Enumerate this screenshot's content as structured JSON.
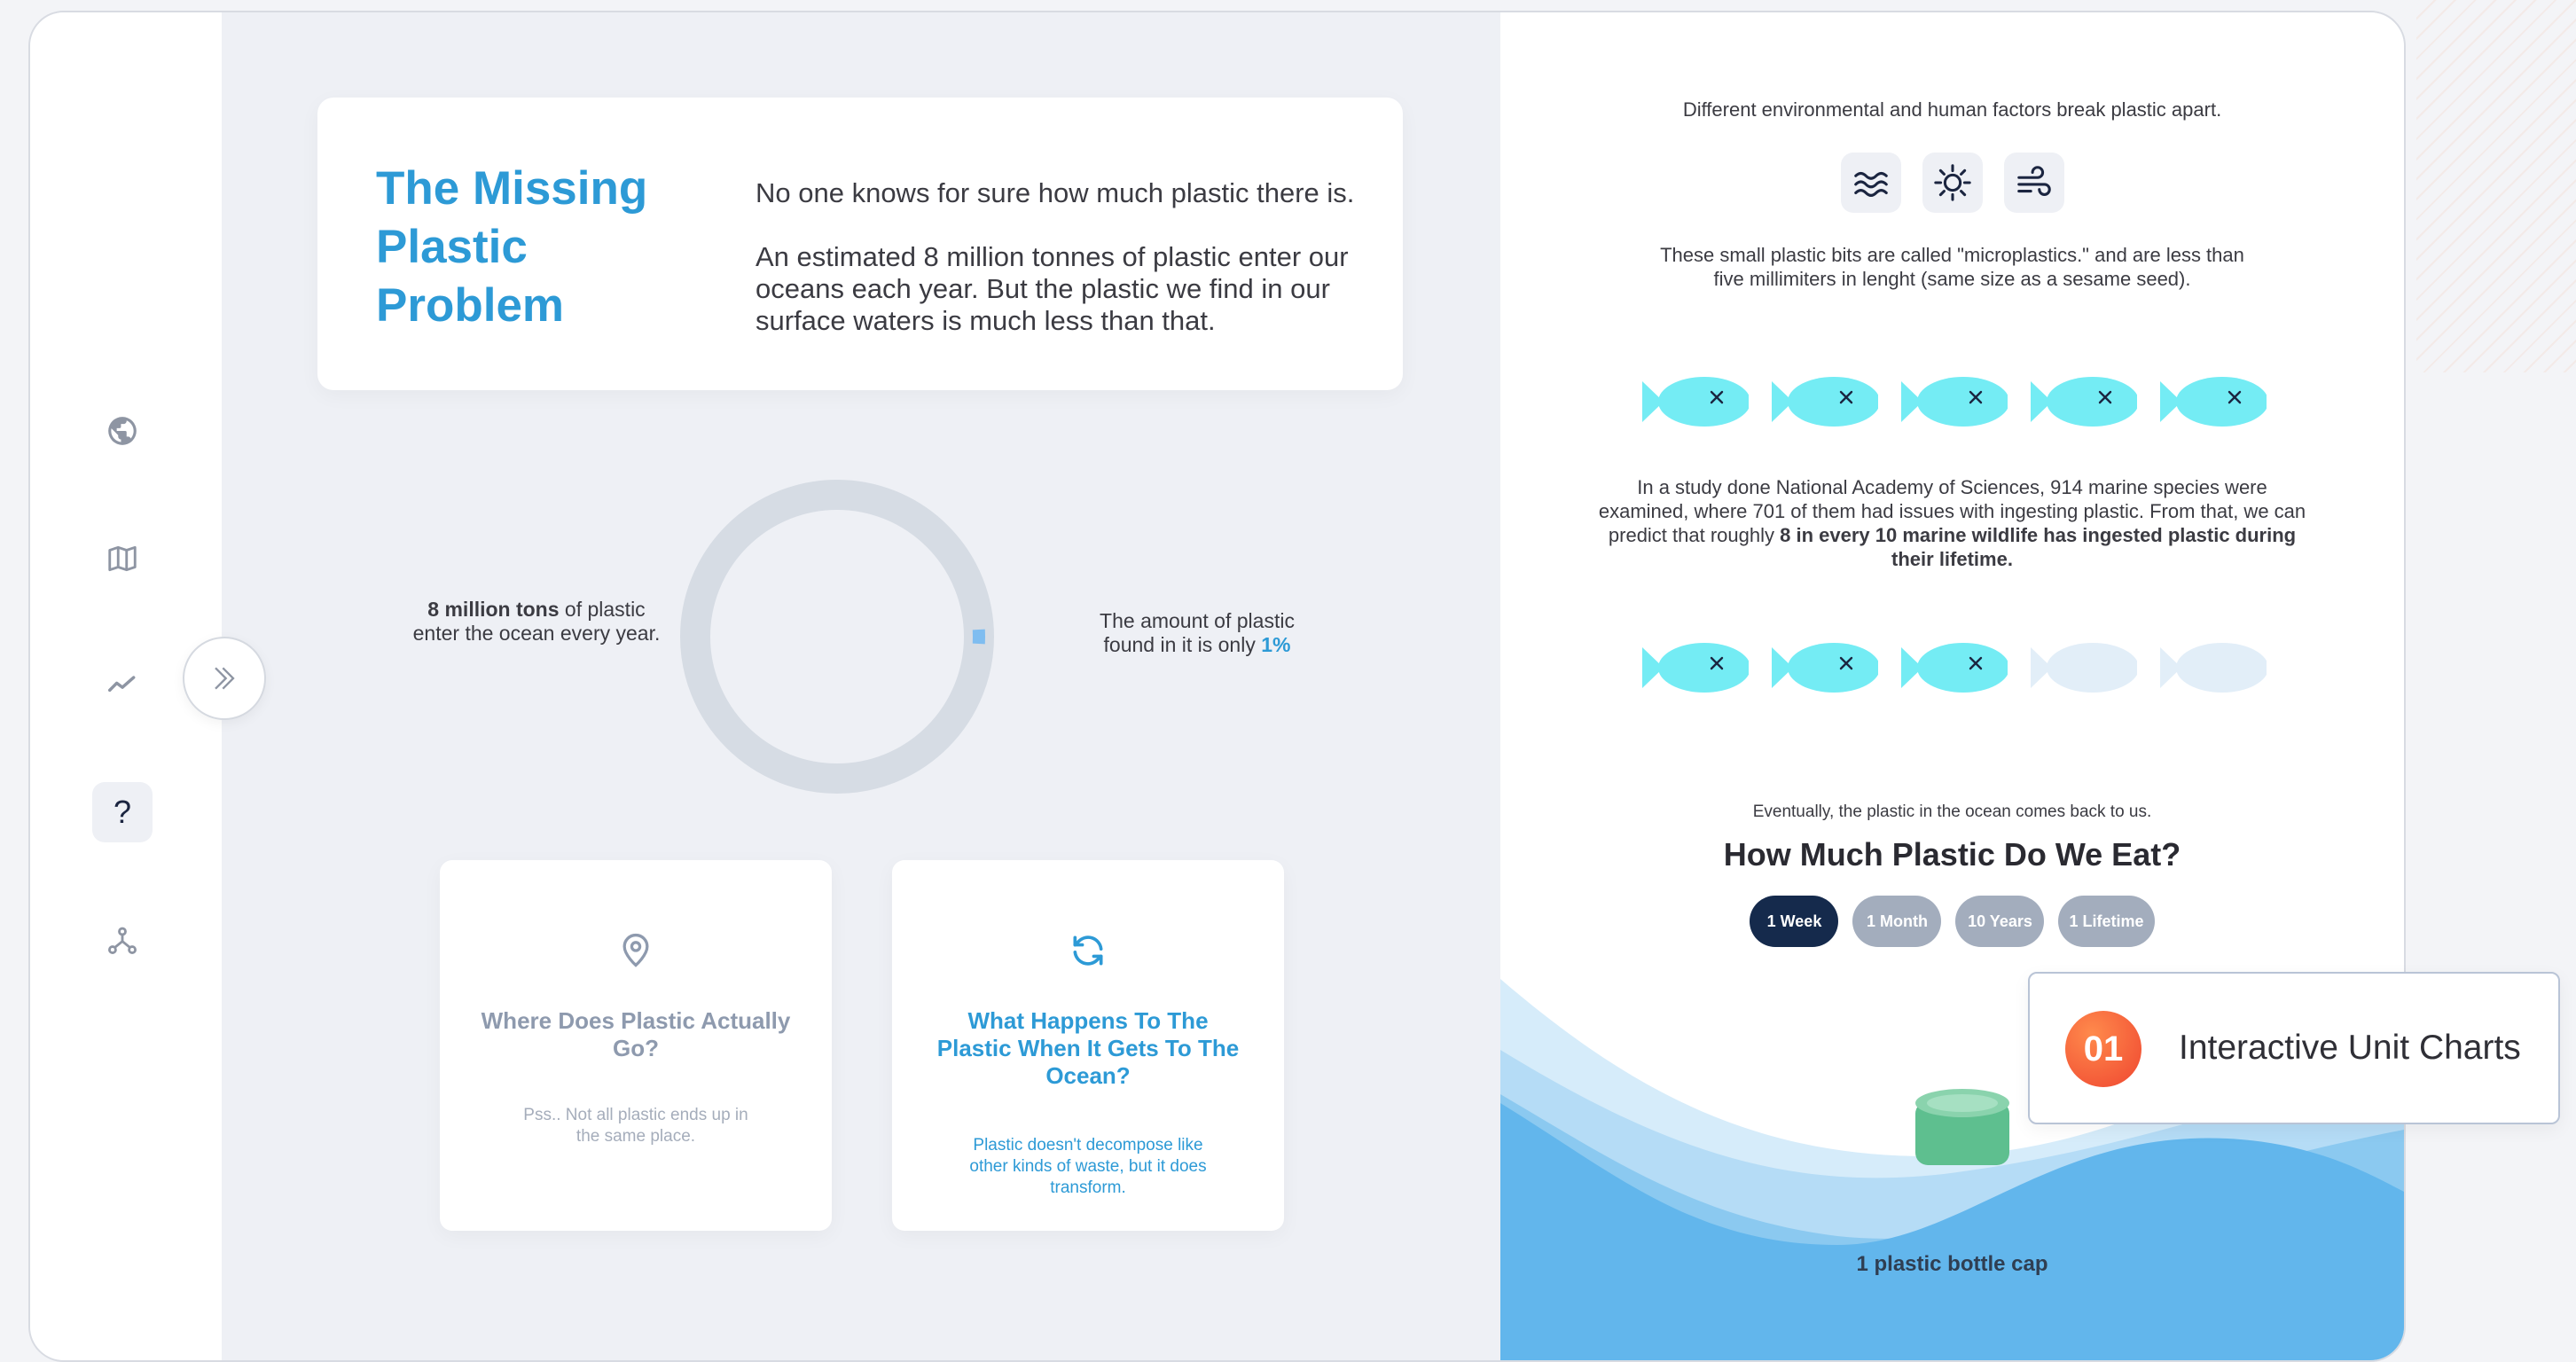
{
  "intro": {
    "title": "The Missing Plastic Problem",
    "p1": "No one knows for sure how much plastic there is.",
    "p2": "An estimated 8 million tonnes of plastic enter our oceans each year. But the plastic we find in our surface waters is much less than that."
  },
  "donut": {
    "left_bold": "8 million tons",
    "left_rest": " of plastic enter the ocean every year.",
    "right_text": "The amount of plastic found in it is only ",
    "right_value": "1%",
    "percent": 1,
    "colors": {
      "track": "#d6dce4",
      "value": "#7fbdf0"
    }
  },
  "cards": [
    {
      "title": "Where Does Plastic Actually Go?",
      "desc": "Pss.. Not all plastic ends up in the same place.",
      "icon": "map-pin-icon",
      "color": "#8e9aae"
    },
    {
      "title": "What Happens To The Plastic When It Gets To The Ocean?",
      "desc": "Plastic doesn't decompose like other kinds of waste, but it does transform.",
      "icon": "refresh-icon",
      "color": "#2d9ad6"
    }
  ],
  "right": {
    "factors_text": "Different environmental and human factors break plastic apart.",
    "factor_icons": [
      "waves-icon",
      "sun-icon",
      "wind-icon"
    ],
    "micro_text": "These small plastic bits are called \"microplastics.\" and are less than five millimiters in lenght (same size as a sesame seed).",
    "study_text": "In a study done National Academy of Sciences, 914 marine species were examined, where 701 of them had issues with ingesting plastic. From that, we can predict that roughly ",
    "study_bold": "8 in every 10 marine wildlife has ingested plastic during their lifetime.",
    "fish_row1_ingested": 5,
    "fish_row2_ingested": 3,
    "fish_per_row": 5,
    "eat_intro": "Eventually, the plastic in the ocean comes back to us.",
    "eat_title": "How Much Plastic Do We Eat?",
    "tabs": [
      "1 Week",
      "1 Month",
      "10 Years",
      "1 Lifetime"
    ],
    "active_tab": "1 Week",
    "cap_label": "1 plastic bottle cap"
  },
  "badge": {
    "number": "01",
    "label": "Interactive Unit Charts"
  },
  "nav_icons": [
    "globe-icon",
    "map-icon",
    "trend-icon",
    "question-icon",
    "nodes-icon"
  ],
  "colors": {
    "accent": "#2d9ad6",
    "fish_active": "#74ecf4",
    "fish_inactive": "#e2eef8",
    "navy": "#152a4c"
  }
}
